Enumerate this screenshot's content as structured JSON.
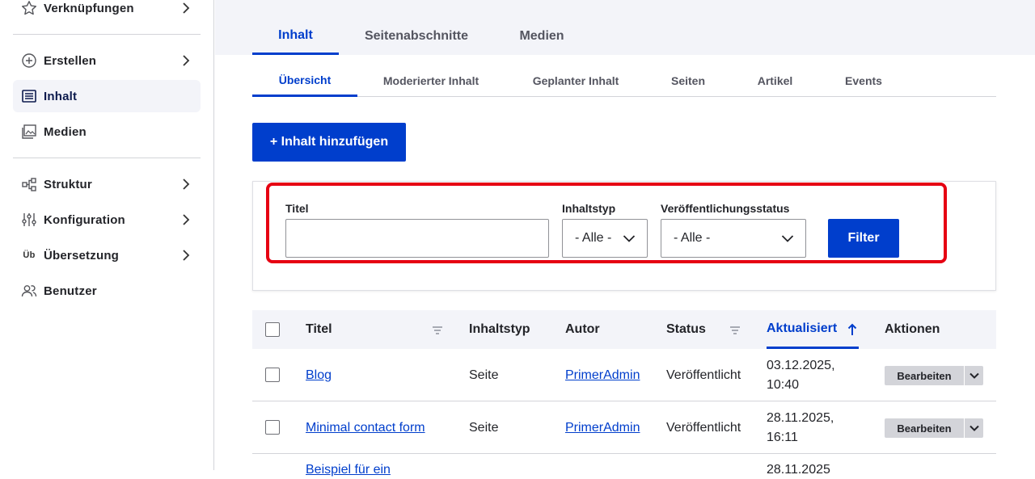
{
  "sidebar": {
    "items": [
      {
        "label": "Verknüpfungen",
        "icon": "star-icon"
      },
      {
        "label": "Erstellen",
        "icon": "plus-circle-icon"
      },
      {
        "label": "Inhalt",
        "icon": "content-list-icon"
      },
      {
        "label": "Medien",
        "icon": "media-icon"
      },
      {
        "label": "Struktur",
        "icon": "structure-icon"
      },
      {
        "label": "Konfiguration",
        "icon": "sliders-icon"
      },
      {
        "label": "Übersetzung",
        "icon": "translation-icon",
        "icon_text": "Üb"
      },
      {
        "label": "Benutzer",
        "icon": "users-icon"
      }
    ]
  },
  "primary_tabs": [
    "Inhalt",
    "Seitenabschnitte",
    "Medien"
  ],
  "secondary_tabs": [
    "Übersicht",
    "Moderierter Inhalt",
    "Geplanter Inhalt",
    "Seiten",
    "Artikel",
    "Events"
  ],
  "add_button": "+ Inhalt hinzufügen",
  "filter": {
    "title_label": "Titel",
    "title_value": "",
    "type_label": "Inhaltstyp",
    "type_value": "- Alle -",
    "status_label": "Veröffentlichungsstatus",
    "status_value": "- Alle -",
    "submit": "Filter"
  },
  "table": {
    "headers": [
      "Titel",
      "Inhaltstyp",
      "Autor",
      "Status",
      "Aktualisiert",
      "Aktionen"
    ],
    "rows": [
      {
        "title": "Blog",
        "type": "Seite",
        "author": "PrimerAdmin",
        "status": "Veröffentlicht",
        "updated_date": "03.12.2025,",
        "updated_time": "10:40",
        "action": "Bearbeiten"
      },
      {
        "title": "Minimal contact form",
        "type": "Seite",
        "author": "PrimerAdmin",
        "status": "Veröffentlicht",
        "updated_date": "28.11.2025,",
        "updated_time": "16:11",
        "action": "Bearbeiten"
      },
      {
        "title": "Beispiel für ein",
        "updated_date": "28.11.2025"
      }
    ]
  },
  "colors": {
    "accent": "#003ecc",
    "highlight": "#e60012"
  }
}
